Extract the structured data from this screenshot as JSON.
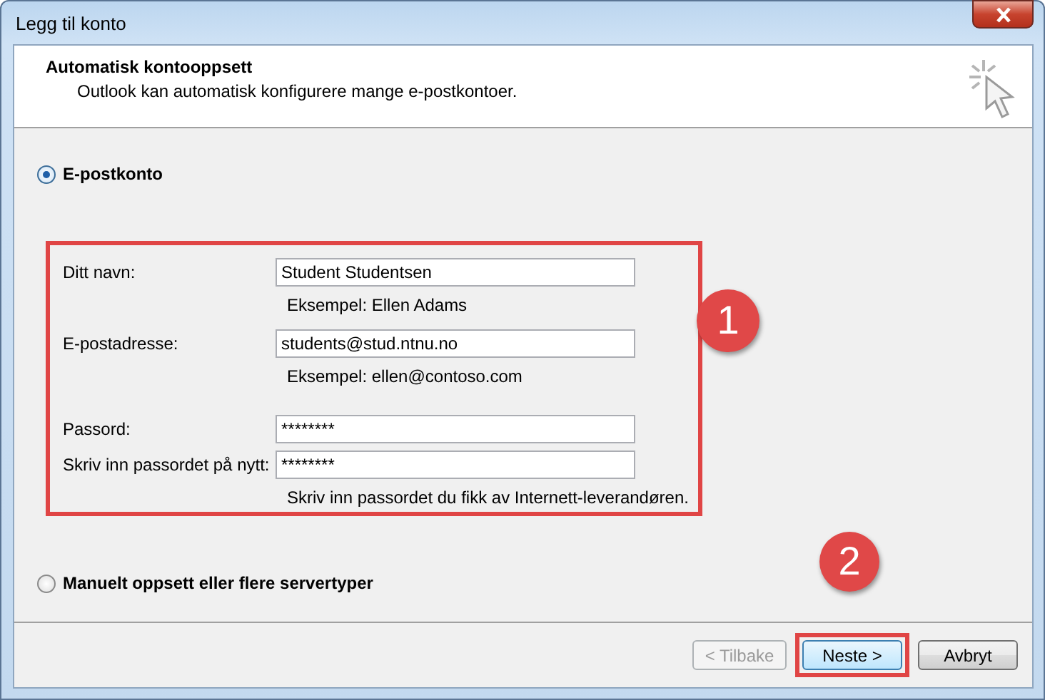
{
  "window": {
    "title": "Legg til konto"
  },
  "header": {
    "title": "Automatisk kontooppsett",
    "subtitle": "Outlook kan automatisk konfigurere mange e-postkontoer."
  },
  "options": [
    {
      "label": "E-postkonto",
      "selected": true
    },
    {
      "label": "Manuelt oppsett eller flere servertyper",
      "selected": false
    }
  ],
  "fields": [
    {
      "label": "Ditt navn:",
      "value": "Student Studentsen",
      "hint": "Eksempel: Ellen Adams"
    },
    {
      "label": "E-postadresse:",
      "value": "students@stud.ntnu.no",
      "hint": "Eksempel: ellen@contoso.com"
    },
    {
      "label": "Passord:",
      "value": "********"
    },
    {
      "label": "Skriv inn passordet på nytt:",
      "value": "********",
      "hint": "Skriv inn passordet du fikk av Internett-leverandøren."
    }
  ],
  "annotations": [
    "1",
    "2"
  ],
  "buttons": [
    {
      "label": "< Tilbake",
      "disabled": true,
      "highlighted": false
    },
    {
      "label": "Neste >",
      "disabled": false,
      "highlighted": true
    },
    {
      "label": "Avbryt",
      "disabled": false,
      "highlighted": false
    }
  ]
}
